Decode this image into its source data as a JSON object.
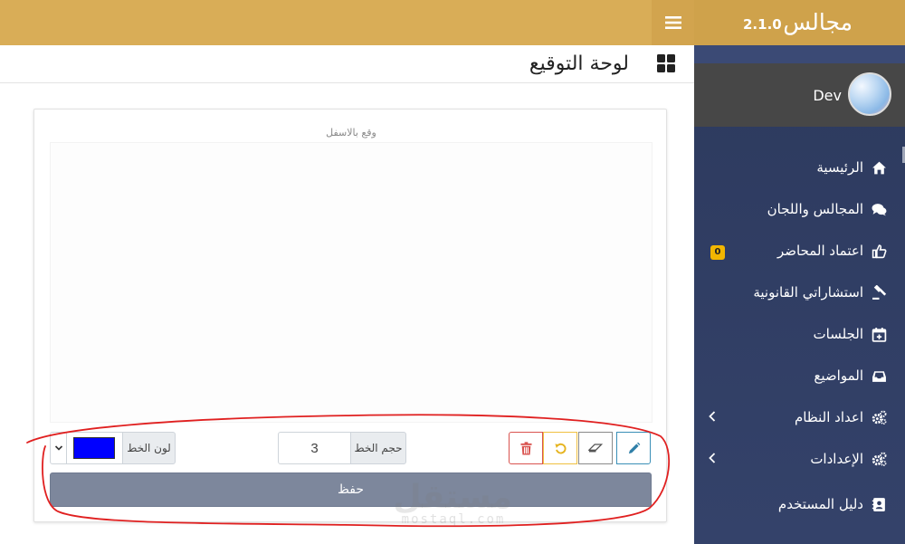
{
  "app": {
    "brand_name": "مجالس",
    "version": "2.1.0"
  },
  "user": {
    "name": "Dev"
  },
  "sidebar": {
    "items": [
      {
        "label": "الرئيسية",
        "icon": "home-icon"
      },
      {
        "label": "المجالس واللجان",
        "icon": "comments-icon"
      },
      {
        "label": "اعتماد المحاضر",
        "icon": "thumbs-up-icon",
        "badge": "0"
      },
      {
        "label": "استشاراتي القانونية",
        "icon": "gavel-icon"
      },
      {
        "label": "الجلسات",
        "icon": "calendar-plus-icon"
      },
      {
        "label": "المواضيع",
        "icon": "inbox-icon"
      },
      {
        "label": "اعداد النظام",
        "icon": "cogs-icon",
        "expandable": true
      },
      {
        "label": "الإعدادات",
        "icon": "cogs-icon",
        "expandable": true
      },
      {
        "label": "دليل المستخدم",
        "icon": "address-book-icon"
      }
    ]
  },
  "page": {
    "title": "لوحة التوقيع",
    "title_icon": "dashboard-grid-icon"
  },
  "signature": {
    "hint": "وقع بالاسفل",
    "tools": [
      "pencil-icon",
      "eraser-icon",
      "undo-icon",
      "trash-icon"
    ],
    "line_size_label": "حجم الخط",
    "line_size_value": "3",
    "line_color_label": "لون الخط",
    "line_color": "#0000ff",
    "save_label": "حفظ"
  },
  "watermark": {
    "arabic": "مستقل",
    "latin": "mostaql.com"
  },
  "colors": {
    "topbar": "#d9ad57",
    "sidebar": "#2d3a5e",
    "badge": "#f2b600",
    "save_button": "#7d879c",
    "annotation_loop": "#e02020"
  }
}
